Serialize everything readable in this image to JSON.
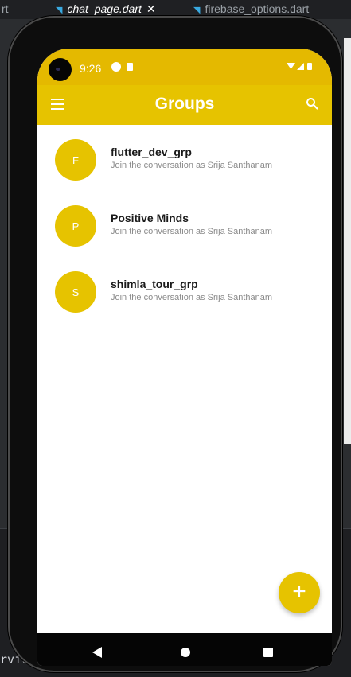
{
  "ide": {
    "tabs": [
      {
        "label": "rt"
      },
      {
        "label": "chat_page.dart",
        "close": "✕"
      },
      {
        "label": "firebase_options.dart"
      }
    ],
    "terminal_text": "rvic"
  },
  "status_bar": {
    "time": "9:26"
  },
  "app_bar": {
    "title": "Groups",
    "menu_icon": "menu-icon",
    "search_icon": "search-icon"
  },
  "groups": [
    {
      "initial": "F",
      "name": "flutter_dev_grp",
      "subtitle": "Join the conversation as Srija Santhanam"
    },
    {
      "initial": "P",
      "name": "Positive Minds",
      "subtitle": "Join the conversation as Srija Santhanam"
    },
    {
      "initial": "S",
      "name": "shimla_tour_grp",
      "subtitle": "Join the conversation as Srija Santhanam"
    }
  ],
  "fab": {
    "label": "+"
  },
  "colors": {
    "accent": "#e6c300",
    "nav_bar": "#050505",
    "ide_background": "#2b2d30"
  }
}
